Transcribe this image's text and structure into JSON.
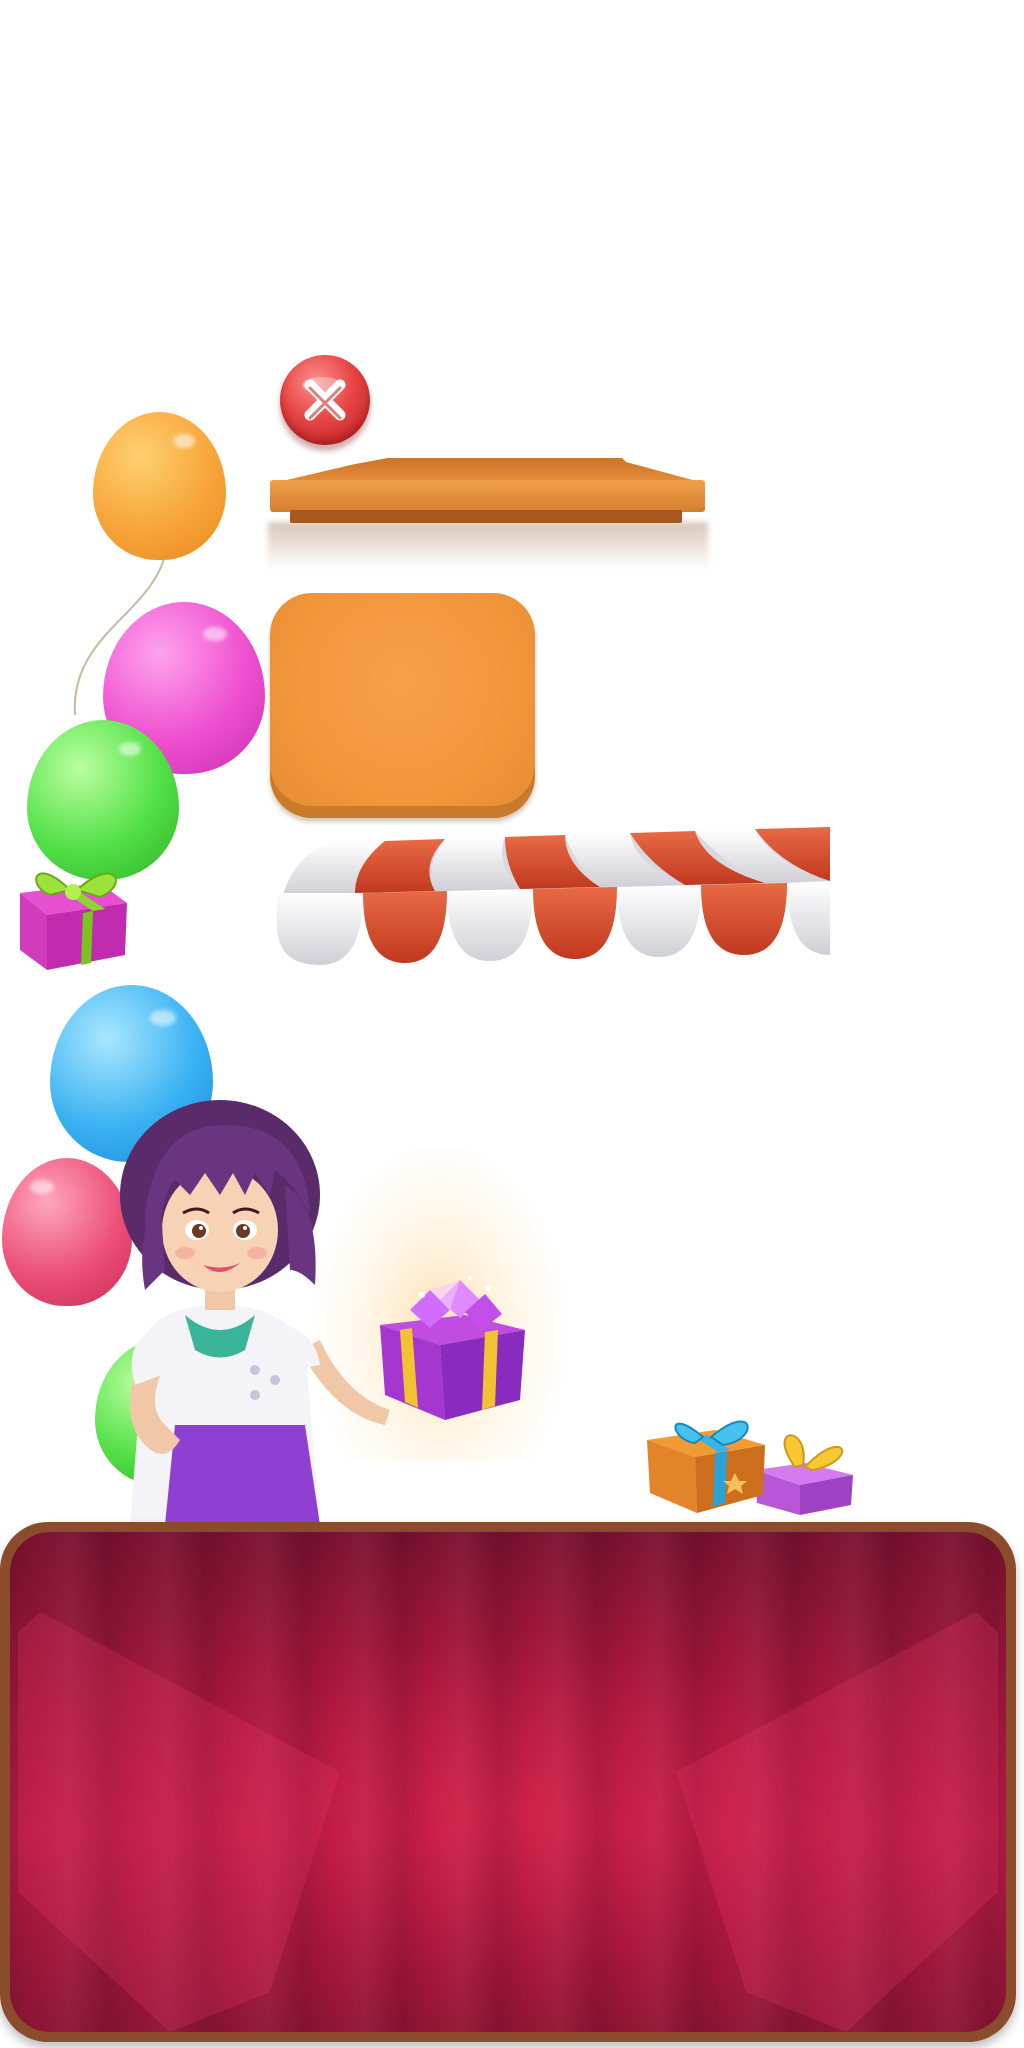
{
  "scene": {
    "type": "game-ui-sprite-sheet",
    "colors": {
      "close_button": "#e84545",
      "shelf_wood": "#e0873a",
      "panel_orange": "#f2963c",
      "awning_red": "#d9432a",
      "awning_white": "#f2f2f2",
      "board_red": "#b81a44",
      "board_frame": "#8a4c2a"
    }
  },
  "icons": {
    "close": "close-icon",
    "gift": "gift-icon",
    "balloon": "balloon-icon",
    "gem": "gem-icon"
  }
}
